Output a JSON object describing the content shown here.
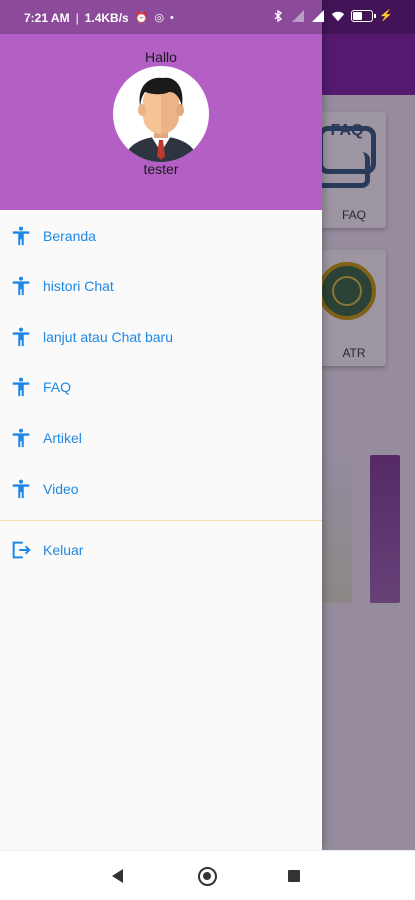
{
  "status_bar": {
    "time": "7:21 AM",
    "network_speed": "1.4KB/s",
    "separator": "|",
    "battery_level_percent": 50
  },
  "background_app": {
    "cards": [
      {
        "label": "FAQ",
        "icon": "faq-chat-icon"
      },
      {
        "label": "ATR",
        "icon": "atr-seal-logo"
      }
    ]
  },
  "drawer": {
    "greeting": "Hallo",
    "username": "tester",
    "header_color": "#b35fc6",
    "accent_color": "#1e88e5",
    "menu": [
      {
        "id": "beranda",
        "label": "Beranda",
        "icon": "accessibility-icon"
      },
      {
        "id": "histori-chat",
        "label": "histori Chat",
        "icon": "accessibility-icon"
      },
      {
        "id": "lanjut-chat",
        "label": "lanjut atau Chat baru",
        "icon": "accessibility-icon"
      },
      {
        "id": "faq",
        "label": "FAQ",
        "icon": "accessibility-icon"
      },
      {
        "id": "artikel",
        "label": "Artikel",
        "icon": "accessibility-icon"
      },
      {
        "id": "video",
        "label": "Video",
        "icon": "accessibility-icon"
      }
    ],
    "logout": {
      "label": "Keluar",
      "icon": "logout-icon"
    }
  },
  "nav_bar": {
    "buttons": [
      "back-icon",
      "home-icon",
      "recents-icon"
    ]
  }
}
